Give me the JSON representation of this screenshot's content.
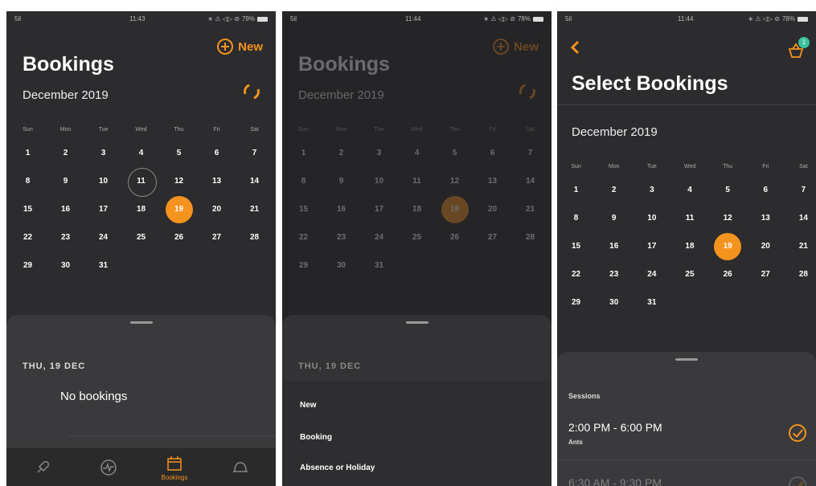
{
  "status": {
    "p1": {
      "signal": "5il",
      "time": "11:43",
      "icons": "∗ ⚠ ◁▷ ⊘",
      "battery": "79%"
    },
    "p2": {
      "signal": "5il",
      "time": "11:44",
      "icons": "∗ ⚠ ◁▷ ⊘",
      "battery": "78%"
    },
    "p3": {
      "signal": "5il",
      "time": "11:44",
      "icons": "∗ ⚠ ◁▷ ⊘",
      "battery": "78%"
    }
  },
  "bookings": {
    "title": "Bookings",
    "month": "December 2019",
    "new_label": "New",
    "weekdays": [
      "Sun",
      "Mon",
      "Tue",
      "Wed",
      "Thu",
      "Fri",
      "Sat"
    ],
    "days": [
      "1",
      "2",
      "3",
      "4",
      "5",
      "6",
      "7",
      "8",
      "9",
      "10",
      "11",
      "12",
      "13",
      "14",
      "15",
      "16",
      "17",
      "18",
      "19",
      "20",
      "21",
      "22",
      "23",
      "24",
      "25",
      "26",
      "27",
      "28",
      "29",
      "30",
      "31"
    ],
    "today": "11",
    "selected": "19",
    "sheet_date": "THU, 19 DEC",
    "empty_text": "No bookings",
    "tabs": [
      {
        "icon": "rocket-icon",
        "label": ""
      },
      {
        "icon": "activity-icon",
        "label": ""
      },
      {
        "icon": "calendar-icon",
        "label": "Bookings"
      },
      {
        "icon": "bell-icon",
        "label": ""
      }
    ]
  },
  "new_menu": {
    "sheet_date": "THU, 19 DEC",
    "items": [
      "New",
      "Booking",
      "Absence or Holiday"
    ]
  },
  "select": {
    "title": "Select Bookings",
    "month": "December 2019",
    "badge": "1",
    "section": "Sessions",
    "sessions": [
      {
        "time": "2:00 PM  -  6:00 PM",
        "name": "Ants",
        "checked": true
      },
      {
        "time": "6:30 AM  -  9:30 PM",
        "name": "",
        "checked": false
      }
    ]
  },
  "colors": {
    "accent": "#f5931f",
    "bg": "#2c2c2e",
    "sheet": "#3a3a3c"
  }
}
